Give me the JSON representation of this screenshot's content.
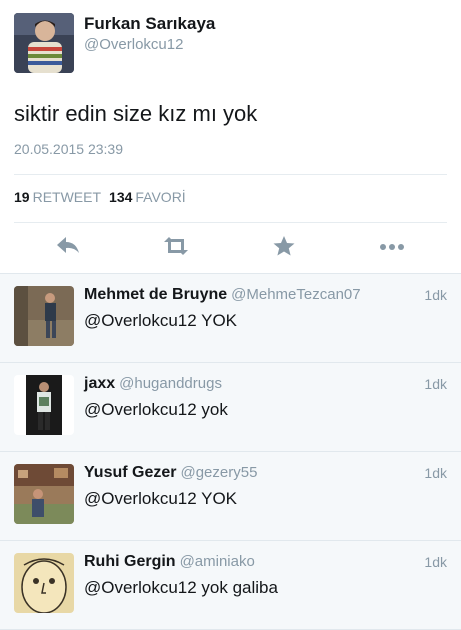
{
  "tweet": {
    "author_name": "Furkan Sarıkaya",
    "author_handle": "@Overlokcu12",
    "text": "siktir edin size kız mı yok",
    "timestamp": "20.05.2015 23:39",
    "retweet_count": "19",
    "retweet_label": "RETWEET",
    "favorite_count": "134",
    "favorite_label": "FAVORİ"
  },
  "actions": {
    "reply_icon": "reply-arrow-icon",
    "retweet_icon": "retweet-icon",
    "favorite_icon": "star-icon",
    "more_icon": "more-dots-icon"
  },
  "replies": [
    {
      "name": "Mehmet de Bruyne",
      "handle": "@MehmeTezcan07",
      "time": "1dk",
      "text": "@Overlokcu12 YOK"
    },
    {
      "name": "jaxx",
      "handle": "@huganddrugs",
      "time": "1dk",
      "text": "@Overlokcu12 yok"
    },
    {
      "name": "Yusuf Gezer",
      "handle": "@gezery55",
      "time": "1dk",
      "text": "@Overlokcu12 YOK"
    },
    {
      "name": "Ruhi Gergin",
      "handle": "@aminiako",
      "time": "1dk",
      "text": "@Overlokcu12 yok galiba"
    }
  ],
  "colors": {
    "primary_text": "#14171a",
    "secondary_text": "#8899a6",
    "action_icon": "#8899a6",
    "reply_background": "#f5f8fa",
    "divider": "#e6ecf0"
  }
}
